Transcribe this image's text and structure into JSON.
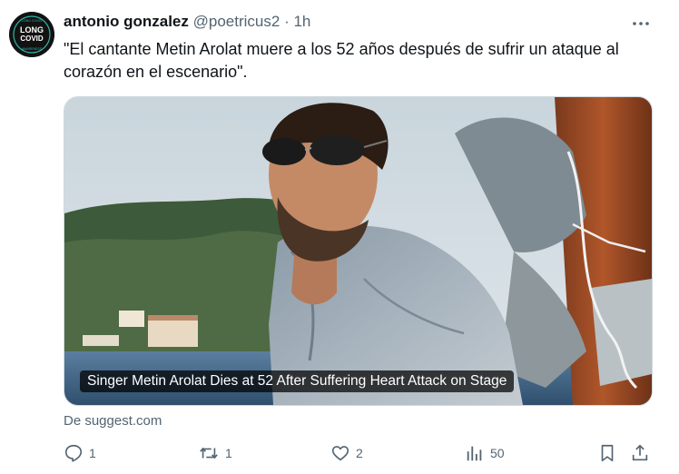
{
  "tweet": {
    "author_name": "antonio gonzalez",
    "handle": "@poetricus2",
    "separator": "·",
    "time": "1h",
    "text": "\"El cantante Metin Arolat muere a los 52 años después de sufrir un ataque al corazón en el escenario\".",
    "avatar_text": {
      "line1": "LONG",
      "line2": "COVID",
      "ring_top": "LONG COVID",
      "ring_bottom": "AWARENESS"
    }
  },
  "card": {
    "caption": "Singer Metin Arolat Dies at 52 After Suffering Heart Attack on Stage",
    "source": "De suggest.com"
  },
  "actions": {
    "reply_count": "1",
    "retweet_count": "1",
    "like_count": "2",
    "view_count": "50"
  },
  "colors": {
    "text": "#0f1419",
    "muted": "#536471",
    "border": "#cfd9de"
  },
  "icons": [
    "more-icon",
    "reply-icon",
    "retweet-icon",
    "like-icon",
    "views-icon",
    "bookmark-icon",
    "share-icon"
  ]
}
